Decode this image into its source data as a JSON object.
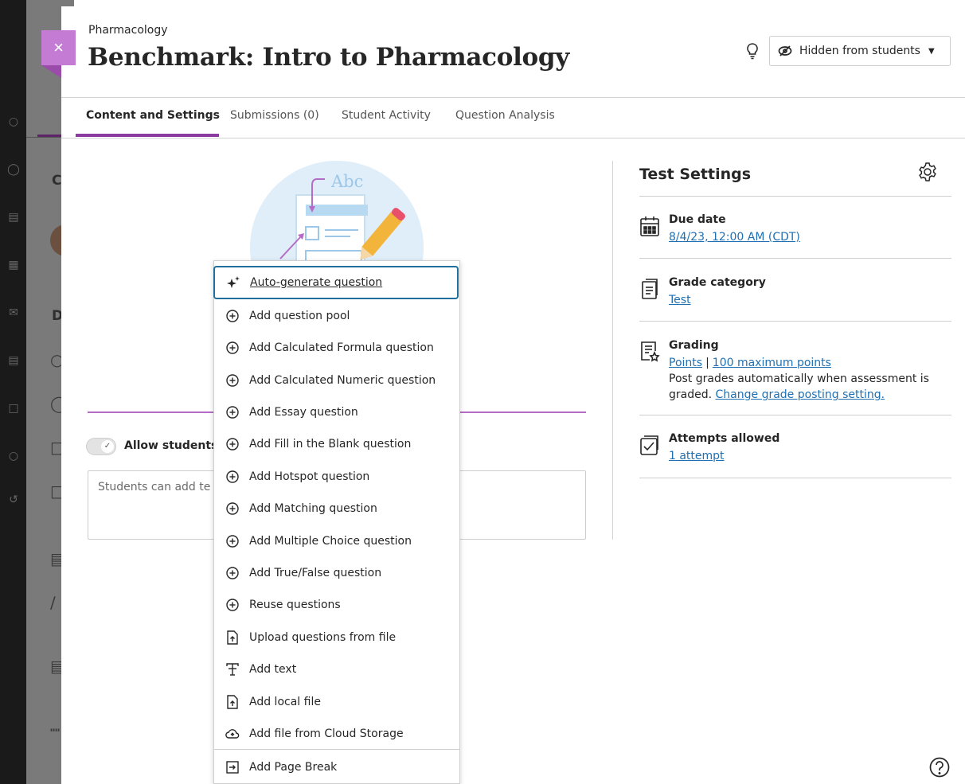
{
  "header": {
    "close_label": "×",
    "breadcrumb": "Pharmacology",
    "title": "Benchmark: Intro to Pharmacology",
    "visibility": "Hidden from students"
  },
  "tabs": [
    {
      "label": "Content and Settings"
    },
    {
      "label": "Submissions (0)"
    },
    {
      "label": "Student Activity"
    },
    {
      "label": "Question Analysis"
    }
  ],
  "illustration": {
    "text": "Abc"
  },
  "content": {
    "allow_label": "Allow students",
    "textbox_placeholder": "Students can add te"
  },
  "menu": {
    "items": [
      {
        "label": "Auto-generate question",
        "icon": "sparkle-icon"
      },
      {
        "label": "Add question pool",
        "icon": "add-circle-icon"
      },
      {
        "label": "Add Calculated Formula question",
        "icon": "add-circle-icon"
      },
      {
        "label": "Add Calculated Numeric question",
        "icon": "add-circle-icon"
      },
      {
        "label": "Add Essay question",
        "icon": "add-circle-icon"
      },
      {
        "label": "Add Fill in the Blank question",
        "icon": "add-circle-icon"
      },
      {
        "label": "Add Hotspot question",
        "icon": "add-circle-icon"
      },
      {
        "label": "Add Matching question",
        "icon": "add-circle-icon"
      },
      {
        "label": "Add Multiple Choice question",
        "icon": "add-circle-icon"
      },
      {
        "label": "Add True/False question",
        "icon": "add-circle-icon"
      },
      {
        "label": "Reuse questions",
        "icon": "add-circle-icon"
      },
      {
        "label": "Upload questions from file",
        "icon": "upload-file-icon"
      },
      {
        "label": "Add text",
        "icon": "text-icon"
      },
      {
        "label": "Add local file",
        "icon": "upload-file-icon"
      },
      {
        "label": "Add file from Cloud Storage",
        "icon": "cloud-icon"
      },
      {
        "label": "Add Page Break",
        "icon": "page-break-icon"
      }
    ]
  },
  "settings": {
    "title": "Test Settings",
    "due_label": "Due date",
    "due_value": "8/4/23, 12:00 AM (CDT)",
    "category_label": "Grade category",
    "category_value": "Test",
    "grading_label": "Grading",
    "grading_type": "Points",
    "grading_separator": "|",
    "grading_points": "100 maximum points",
    "grading_note": "Post grades automatically when assessment is graded.",
    "grading_change": "Change grade posting setting.",
    "attempts_label": "Attempts allowed",
    "attempts_value": "1 attempt"
  },
  "colors": {
    "accent_purple": "#8c3ba0",
    "link_blue": "#1f6fb2",
    "focus_blue": "#1f6e9c"
  }
}
